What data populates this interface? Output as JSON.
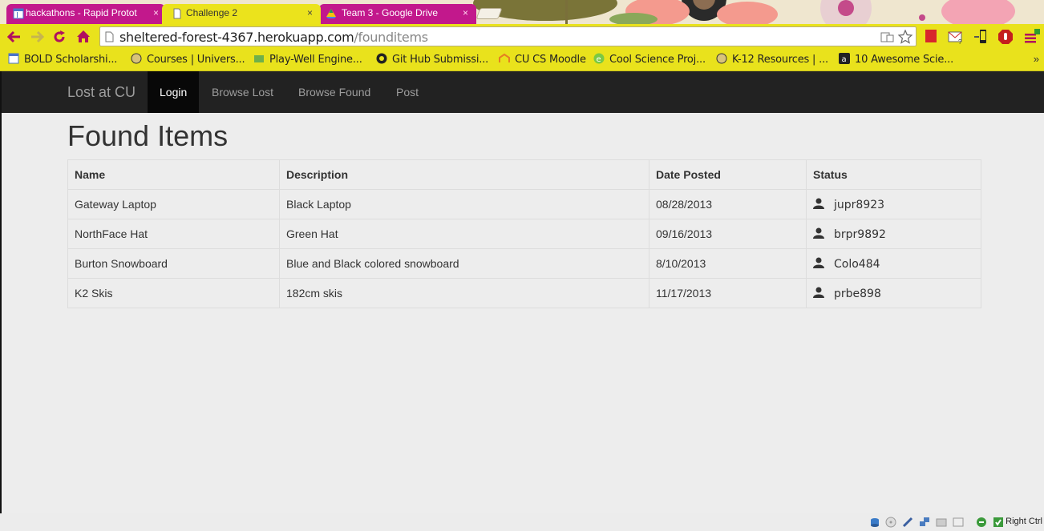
{
  "browser": {
    "tabs": [
      {
        "label": "hackathons - Rapid Protot",
        "favicon": "calendar-icon",
        "active": false
      },
      {
        "label": "Challenge 2",
        "favicon": "page-icon",
        "active": true
      },
      {
        "label": "Team 3 - Google Drive",
        "favicon": "drive-icon",
        "active": false
      }
    ],
    "close_glyph": "×",
    "url": {
      "host": "sheltered-forest-4367.herokuapp.com",
      "path": "/founditems"
    },
    "bookmarks": [
      {
        "label": "BOLD Scholarshi...",
        "icon": "calendar-icon"
      },
      {
        "label": "Courses | Univers...",
        "icon": "cu-icon"
      },
      {
        "label": "Play-Well Engine...",
        "icon": "folder-icon"
      },
      {
        "label": "Git Hub Submissi...",
        "icon": "github-icon"
      },
      {
        "label": "CU CS Moodle",
        "icon": "moodle-icon"
      },
      {
        "label": "Cool Science Proj...",
        "icon": "e-icon"
      },
      {
        "label": "K-12 Resources | ...",
        "icon": "cu-icon"
      },
      {
        "label": "10 Awesome Scie...",
        "icon": "amazon-icon"
      }
    ],
    "bookmarks_more": "»",
    "colors": {
      "tab_inactive": "#c2188c",
      "toolbar": "#e9e21c"
    }
  },
  "navbar": {
    "brand": "Lost at CU",
    "items": [
      {
        "label": "Login",
        "active": true
      },
      {
        "label": "Browse Lost",
        "active": false
      },
      {
        "label": "Browse Found",
        "active": false
      },
      {
        "label": "Post",
        "active": false
      }
    ]
  },
  "main": {
    "title": "Found Items",
    "table": {
      "headers": [
        "Name",
        "Description",
        "Date Posted",
        "Status"
      ],
      "rows": [
        {
          "name": "Gateway Laptop",
          "description": "Black Laptop",
          "date": "08/28/2013",
          "user": "jupr8923"
        },
        {
          "name": "NorthFace Hat",
          "description": "Green Hat",
          "date": "09/16/2013",
          "user": "brpr9892"
        },
        {
          "name": "Burton Snowboard",
          "description": "Blue and Black colored snowboard",
          "date": "8/10/2013",
          "user": "Colo484"
        },
        {
          "name": "K2 Skis",
          "description": "182cm skis",
          "date": "11/17/2013",
          "user": "prbe898"
        }
      ]
    }
  },
  "statusbar": {
    "host_key": "Right Ctrl"
  }
}
